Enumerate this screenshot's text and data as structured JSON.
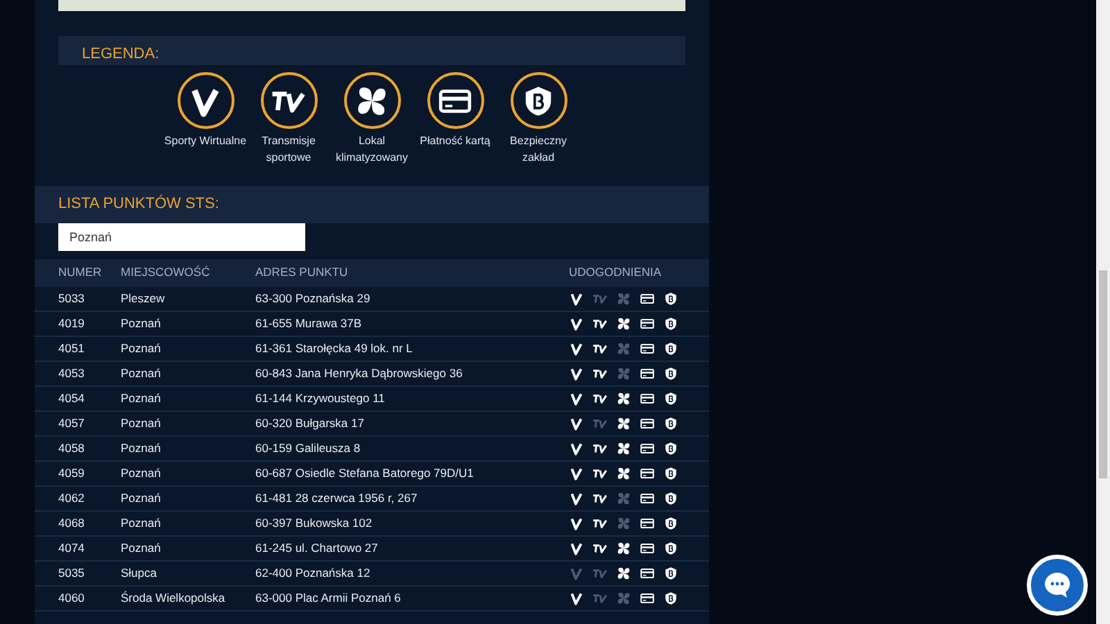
{
  "legend": {
    "title": "LEGENDA:",
    "items": [
      {
        "kind": "virtual",
        "label": "Sporty Wirtualne"
      },
      {
        "kind": "tv",
        "label": "Transmisje sportowe"
      },
      {
        "kind": "aircon",
        "label": "Lokal klimatyzowany"
      },
      {
        "kind": "card",
        "label": "Płatność kartą"
      },
      {
        "kind": "safe",
        "label": "Bezpieczny zakład"
      }
    ]
  },
  "list": {
    "title": "LISTA PUNKTÓW STS:",
    "search": {
      "value": "Poznań"
    },
    "columns": [
      "NUMER",
      "MIEJSCOWOŚĆ",
      "ADRES PUNKTU",
      "UDOGODNIENIA"
    ],
    "rows": [
      {
        "number": "5033",
        "city": "Pleszew",
        "address": "63-300 Poznańska 29",
        "amenities": [
          true,
          false,
          false,
          true,
          true
        ]
      },
      {
        "number": "4019",
        "city": "Poznań",
        "address": "61-655 Murawa 37B",
        "amenities": [
          true,
          true,
          true,
          true,
          true
        ]
      },
      {
        "number": "4051",
        "city": "Poznań",
        "address": "61-361 Starołęcka 49 lok. nr L",
        "amenities": [
          true,
          true,
          false,
          true,
          true
        ]
      },
      {
        "number": "4053",
        "city": "Poznań",
        "address": "60-843 Jana Henryka Dąbrowskiego 36",
        "amenities": [
          true,
          true,
          false,
          true,
          true
        ]
      },
      {
        "number": "4054",
        "city": "Poznań",
        "address": "61-144 Krzywoustego 11",
        "amenities": [
          true,
          true,
          true,
          true,
          true
        ]
      },
      {
        "number": "4057",
        "city": "Poznań",
        "address": "60-320 Bułgarska 17",
        "amenities": [
          true,
          false,
          true,
          true,
          true
        ]
      },
      {
        "number": "4058",
        "city": "Poznań",
        "address": "60-159 Galileusza 8",
        "amenities": [
          true,
          true,
          true,
          true,
          true
        ]
      },
      {
        "number": "4059",
        "city": "Poznań",
        "address": "60-687 Osiedle Stefana Batorego 79D/U1",
        "amenities": [
          true,
          true,
          true,
          true,
          true
        ]
      },
      {
        "number": "4062",
        "city": "Poznań",
        "address": "61-481 28 czerwca 1956 r, 267",
        "amenities": [
          true,
          true,
          false,
          true,
          true
        ]
      },
      {
        "number": "4068",
        "city": "Poznań",
        "address": "60-397 Bukowska 102",
        "amenities": [
          true,
          true,
          false,
          true,
          true
        ]
      },
      {
        "number": "4074",
        "city": "Poznań",
        "address": "61-245 ul. Chartowo 27",
        "amenities": [
          true,
          true,
          true,
          true,
          true
        ]
      },
      {
        "number": "5035",
        "city": "Słupca",
        "address": "62-400 Poznańska 12",
        "amenities": [
          false,
          false,
          true,
          true,
          true
        ]
      },
      {
        "number": "4060",
        "city": "Środa Wielkopolska",
        "address": "63-000 Plac Armii Poznań 6",
        "amenities": [
          true,
          false,
          false,
          true,
          true
        ]
      }
    ]
  }
}
